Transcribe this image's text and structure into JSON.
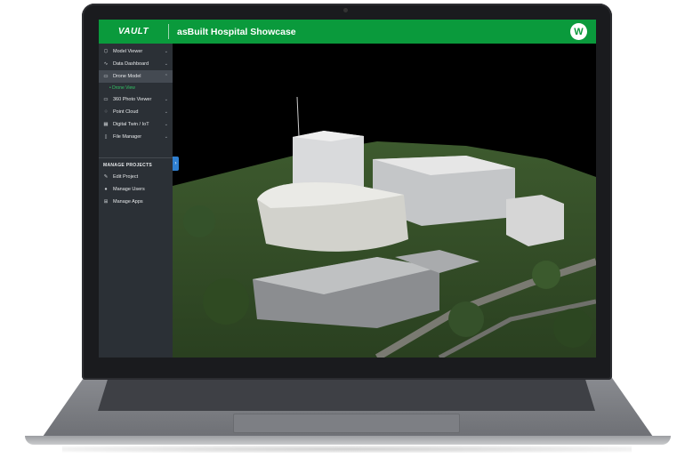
{
  "header": {
    "logo": "VAULT",
    "title": "asBuilt Hospital Showcase",
    "app_icon_glyph": "W"
  },
  "sidebar": {
    "items": [
      {
        "label": "Model Viewer",
        "icon": "cube-icon",
        "expandable": true
      },
      {
        "label": "Data Dashboard",
        "icon": "chart-icon",
        "expandable": true
      },
      {
        "label": "Drone Model",
        "icon": "camera-icon",
        "expandable": true,
        "active": true
      },
      {
        "label": "360 Photo Viewer",
        "icon": "panorama-icon",
        "expandable": true
      },
      {
        "label": "Point Cloud",
        "icon": "point-cloud-icon",
        "expandable": true
      },
      {
        "label": "Digital Twin / IoT",
        "icon": "building-icon",
        "expandable": true
      },
      {
        "label": "File Manager",
        "icon": "file-icon",
        "expandable": true
      }
    ],
    "sub_items": [
      {
        "label": "• Drone View"
      }
    ],
    "manage_section_label": "MANAGE PROJECTS",
    "manage_items": [
      {
        "label": "Edit Project",
        "icon": "pencil-icon"
      },
      {
        "label": "Manage Users",
        "icon": "user-icon"
      },
      {
        "label": "Manage Apps",
        "icon": "grid-icon"
      }
    ]
  },
  "colors": {
    "brand_green": "#0a9a3c",
    "sidebar_bg": "#2b3036",
    "active_sub_item": "#33c466",
    "collapse_handle": "#2f7fd0"
  },
  "viewport": {
    "content": "3D drone photogrammetry model of hospital campus"
  }
}
